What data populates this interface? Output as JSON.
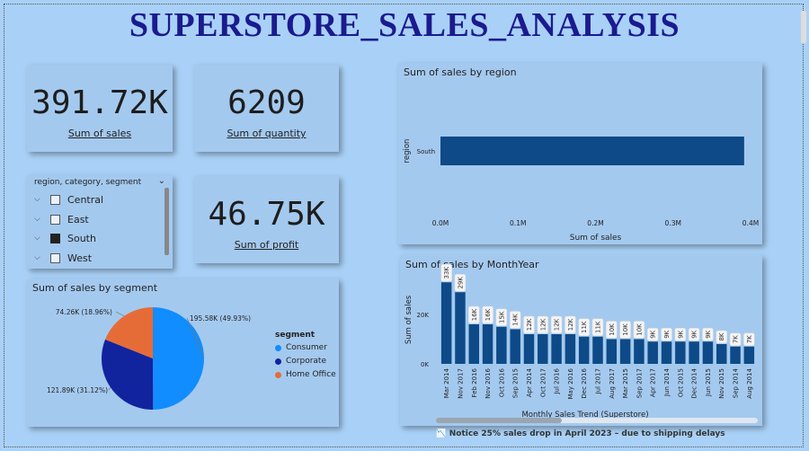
{
  "title": "SUPERSTORE_SALES_ANALYSIS",
  "kpis": {
    "sales": {
      "value": "391.72K",
      "label": "Sum of sales"
    },
    "quantity": {
      "value": "6209",
      "label": "Sum of quantity"
    },
    "profit": {
      "value": "46.75K",
      "label": "Sum of profit"
    }
  },
  "slicer": {
    "title": "region, category, segment",
    "items": [
      {
        "label": "Central",
        "checked": false
      },
      {
        "label": "East",
        "checked": false
      },
      {
        "label": "South",
        "checked": true
      },
      {
        "label": "West",
        "checked": false
      }
    ]
  },
  "note": "📉 Notice 25% sales drop in April 2023 – due to shipping delays",
  "colors": {
    "bar": "#0d4a87",
    "consumer": "#118dff",
    "corporate": "#12239e",
    "home_office": "#e66c37"
  },
  "chart_data": [
    {
      "type": "bar",
      "title": "Sum of sales by region",
      "orientation": "horizontal",
      "categories": [
        "South"
      ],
      "values": [
        391.72
      ],
      "xlabel": "Sum of sales",
      "ylabel": "region",
      "xlim": [
        0,
        0.4
      ],
      "x_ticks": [
        "0.0M",
        "0.1M",
        "0.2M",
        "0.3M",
        "0.4M"
      ],
      "x_unit_scale": 0.001
    },
    {
      "type": "bar",
      "title": "Sum of sales by MonthYear",
      "categories": [
        "Mar 2014",
        "Nov 2017",
        "Feb 2016",
        "Nov 2016",
        "Oct 2016",
        "Sep 2015",
        "Apr 2014",
        "Oct 2017",
        "Jul 2016",
        "May 2016",
        "Dec 2016",
        "Jul 2017",
        "Aug 2017",
        "Mar 2015",
        "Sep 2017",
        "Apr 2017",
        "Jun 2014",
        "Oct 2015",
        "Dec 2014",
        "Jun 2015",
        "Nov 2015",
        "Sep 2014",
        "Aug 2014"
      ],
      "values": [
        33,
        29,
        16,
        16,
        15,
        14,
        12,
        12,
        12,
        12,
        11,
        11,
        10,
        10,
        10,
        9,
        9,
        9,
        9,
        9,
        8,
        7,
        7
      ],
      "data_labels": [
        "33K",
        "29K",
        "16K",
        "16K",
        "15K",
        "14K",
        "12K",
        "12K",
        "12K",
        "12K",
        "11K",
        "11K",
        "10K",
        "10K",
        "10K",
        "9K",
        "9K",
        "9K",
        "9K",
        "9K",
        "8K",
        "7K",
        "7K"
      ],
      "xlabel": "Monthly Sales Trend (Superstore)",
      "ylabel": "Sum of sales",
      "y_ticks": [
        "0K",
        "20K"
      ],
      "ylim": [
        0,
        36
      ]
    },
    {
      "type": "pie",
      "title": "Sum of sales by segment",
      "legend_title": "segment",
      "categories": [
        "Consumer",
        "Corporate",
        "Home Office"
      ],
      "values": [
        195.58,
        121.89,
        74.26
      ],
      "data_labels": [
        "195.58K (49.93%)",
        "121.89K (31.12%)",
        "74.26K (18.96%)"
      ]
    }
  ]
}
